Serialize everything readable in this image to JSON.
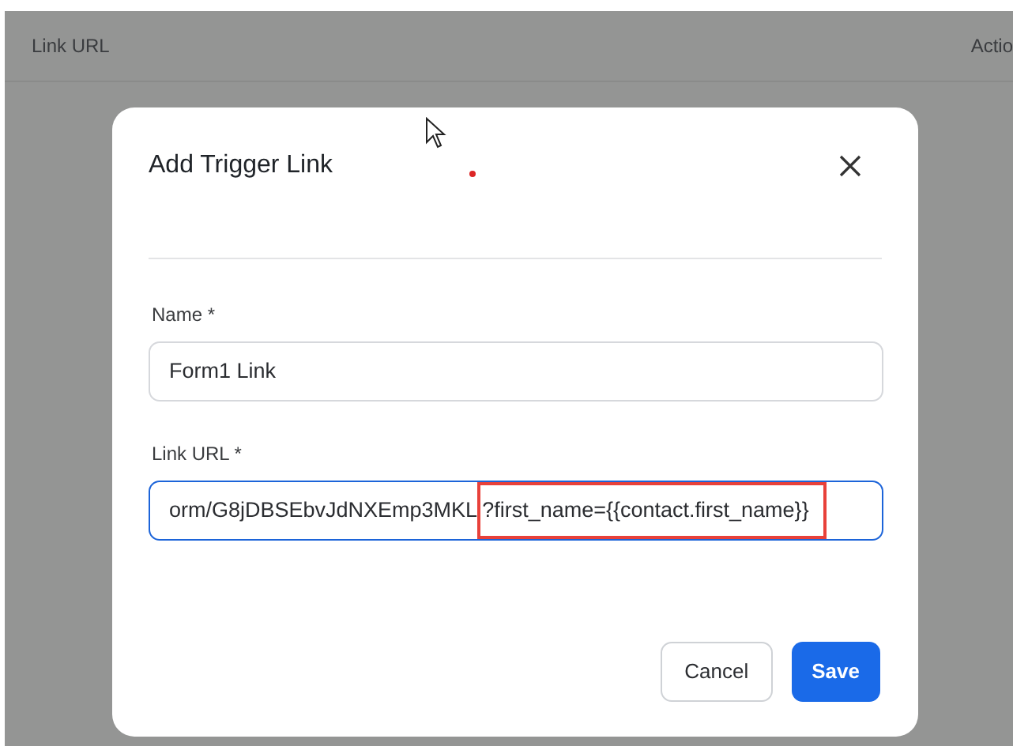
{
  "table": {
    "columns": [
      "Link URL",
      "Actio"
    ]
  },
  "dialog": {
    "title": "Add Trigger Link",
    "fields": [
      {
        "label": "Name *",
        "value": "Form1 Link",
        "focused": false
      },
      {
        "label": "Link URL *",
        "value": "orm/G8jDBSEbvJdNXEmp3MKL",
        "highlighted_value": "?first_name={{contact.first_name}}",
        "focused": true
      }
    ],
    "buttons": [
      {
        "label": "Cancel",
        "kind": "secondary"
      },
      {
        "label": "Save",
        "kind": "primary"
      }
    ]
  }
}
